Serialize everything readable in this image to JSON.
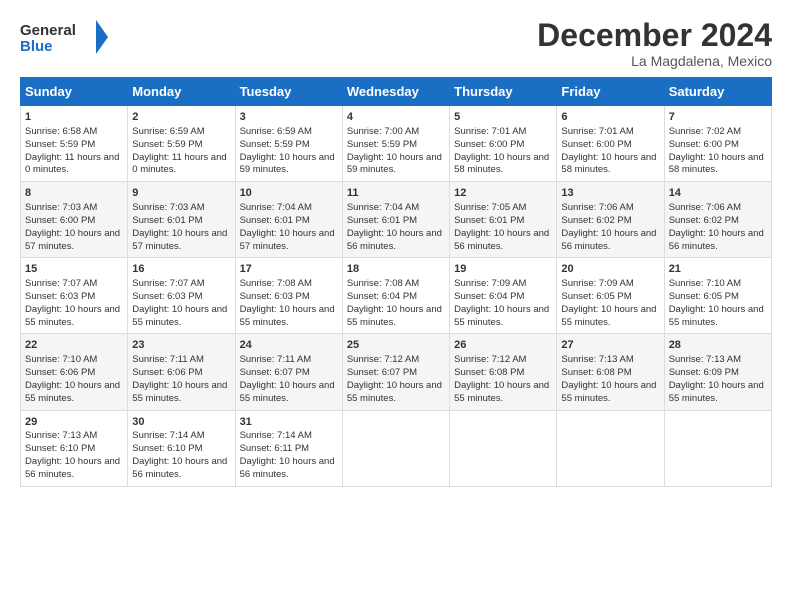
{
  "logo": {
    "line1": "General",
    "line2": "Blue"
  },
  "title": "December 2024",
  "location": "La Magdalena, Mexico",
  "days_of_week": [
    "Sunday",
    "Monday",
    "Tuesday",
    "Wednesday",
    "Thursday",
    "Friday",
    "Saturday"
  ],
  "weeks": [
    [
      {
        "day": "1",
        "sunrise": "6:58 AM",
        "sunset": "5:59 PM",
        "daylight": "11 hours and 0 minutes."
      },
      {
        "day": "2",
        "sunrise": "6:59 AM",
        "sunset": "5:59 PM",
        "daylight": "11 hours and 0 minutes."
      },
      {
        "day": "3",
        "sunrise": "6:59 AM",
        "sunset": "5:59 PM",
        "daylight": "10 hours and 59 minutes."
      },
      {
        "day": "4",
        "sunrise": "7:00 AM",
        "sunset": "5:59 PM",
        "daylight": "10 hours and 59 minutes."
      },
      {
        "day": "5",
        "sunrise": "7:01 AM",
        "sunset": "6:00 PM",
        "daylight": "10 hours and 58 minutes."
      },
      {
        "day": "6",
        "sunrise": "7:01 AM",
        "sunset": "6:00 PM",
        "daylight": "10 hours and 58 minutes."
      },
      {
        "day": "7",
        "sunrise": "7:02 AM",
        "sunset": "6:00 PM",
        "daylight": "10 hours and 58 minutes."
      }
    ],
    [
      {
        "day": "8",
        "sunrise": "7:03 AM",
        "sunset": "6:00 PM",
        "daylight": "10 hours and 57 minutes."
      },
      {
        "day": "9",
        "sunrise": "7:03 AM",
        "sunset": "6:01 PM",
        "daylight": "10 hours and 57 minutes."
      },
      {
        "day": "10",
        "sunrise": "7:04 AM",
        "sunset": "6:01 PM",
        "daylight": "10 hours and 57 minutes."
      },
      {
        "day": "11",
        "sunrise": "7:04 AM",
        "sunset": "6:01 PM",
        "daylight": "10 hours and 56 minutes."
      },
      {
        "day": "12",
        "sunrise": "7:05 AM",
        "sunset": "6:01 PM",
        "daylight": "10 hours and 56 minutes."
      },
      {
        "day": "13",
        "sunrise": "7:06 AM",
        "sunset": "6:02 PM",
        "daylight": "10 hours and 56 minutes."
      },
      {
        "day": "14",
        "sunrise": "7:06 AM",
        "sunset": "6:02 PM",
        "daylight": "10 hours and 56 minutes."
      }
    ],
    [
      {
        "day": "15",
        "sunrise": "7:07 AM",
        "sunset": "6:03 PM",
        "daylight": "10 hours and 55 minutes."
      },
      {
        "day": "16",
        "sunrise": "7:07 AM",
        "sunset": "6:03 PM",
        "daylight": "10 hours and 55 minutes."
      },
      {
        "day": "17",
        "sunrise": "7:08 AM",
        "sunset": "6:03 PM",
        "daylight": "10 hours and 55 minutes."
      },
      {
        "day": "18",
        "sunrise": "7:08 AM",
        "sunset": "6:04 PM",
        "daylight": "10 hours and 55 minutes."
      },
      {
        "day": "19",
        "sunrise": "7:09 AM",
        "sunset": "6:04 PM",
        "daylight": "10 hours and 55 minutes."
      },
      {
        "day": "20",
        "sunrise": "7:09 AM",
        "sunset": "6:05 PM",
        "daylight": "10 hours and 55 minutes."
      },
      {
        "day": "21",
        "sunrise": "7:10 AM",
        "sunset": "6:05 PM",
        "daylight": "10 hours and 55 minutes."
      }
    ],
    [
      {
        "day": "22",
        "sunrise": "7:10 AM",
        "sunset": "6:06 PM",
        "daylight": "10 hours and 55 minutes."
      },
      {
        "day": "23",
        "sunrise": "7:11 AM",
        "sunset": "6:06 PM",
        "daylight": "10 hours and 55 minutes."
      },
      {
        "day": "24",
        "sunrise": "7:11 AM",
        "sunset": "6:07 PM",
        "daylight": "10 hours and 55 minutes."
      },
      {
        "day": "25",
        "sunrise": "7:12 AM",
        "sunset": "6:07 PM",
        "daylight": "10 hours and 55 minutes."
      },
      {
        "day": "26",
        "sunrise": "7:12 AM",
        "sunset": "6:08 PM",
        "daylight": "10 hours and 55 minutes."
      },
      {
        "day": "27",
        "sunrise": "7:13 AM",
        "sunset": "6:08 PM",
        "daylight": "10 hours and 55 minutes."
      },
      {
        "day": "28",
        "sunrise": "7:13 AM",
        "sunset": "6:09 PM",
        "daylight": "10 hours and 55 minutes."
      }
    ],
    [
      {
        "day": "29",
        "sunrise": "7:13 AM",
        "sunset": "6:10 PM",
        "daylight": "10 hours and 56 minutes."
      },
      {
        "day": "30",
        "sunrise": "7:14 AM",
        "sunset": "6:10 PM",
        "daylight": "10 hours and 56 minutes."
      },
      {
        "day": "31",
        "sunrise": "7:14 AM",
        "sunset": "6:11 PM",
        "daylight": "10 hours and 56 minutes."
      },
      {
        "day": "",
        "sunrise": "",
        "sunset": "",
        "daylight": ""
      },
      {
        "day": "",
        "sunrise": "",
        "sunset": "",
        "daylight": ""
      },
      {
        "day": "",
        "sunrise": "",
        "sunset": "",
        "daylight": ""
      },
      {
        "day": "",
        "sunrise": "",
        "sunset": "",
        "daylight": ""
      }
    ]
  ]
}
